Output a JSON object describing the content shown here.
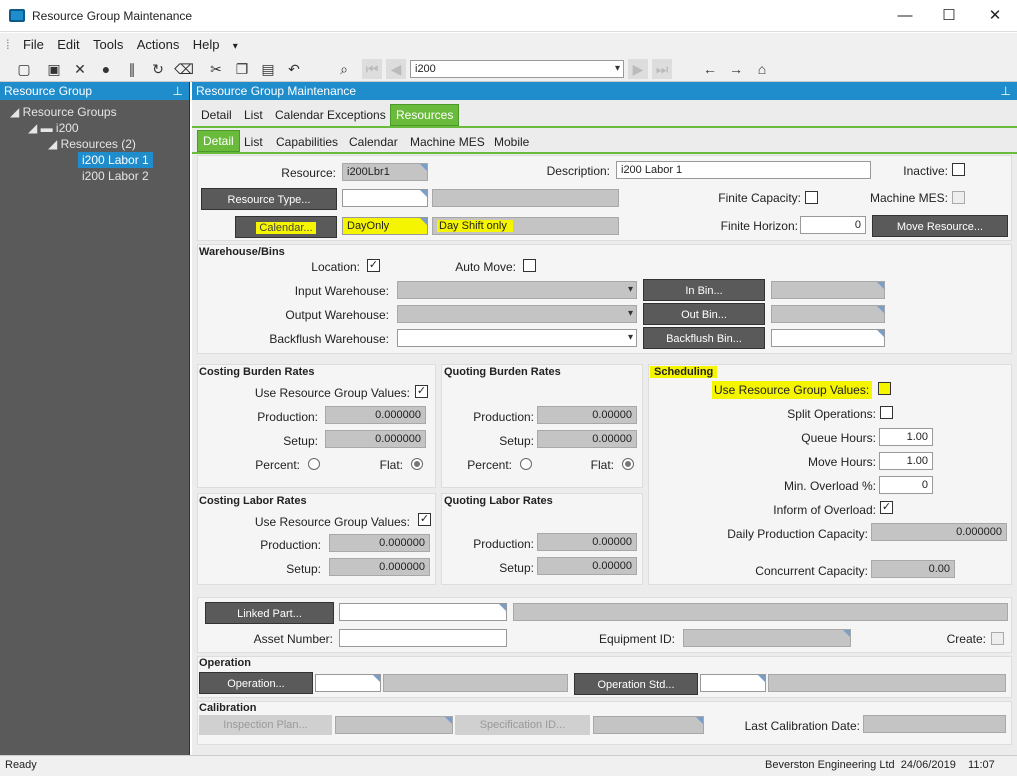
{
  "window": {
    "title": "Resource Group Maintenance",
    "minimize": "—",
    "maximize": "☐",
    "close": "✕"
  },
  "menu": [
    "File",
    "Edit",
    "Tools",
    "Actions",
    "Help"
  ],
  "toolbar": {
    "search_value": "i200"
  },
  "left_pane": {
    "title": "Resource Group",
    "tree": {
      "root": "Resource Groups",
      "group": "i200",
      "resources": "Resources (2)",
      "items": [
        "i200 Labor 1",
        "i200 Labor 2"
      ]
    }
  },
  "main": {
    "title": "Resource Group Maintenance",
    "tabs": [
      "Detail",
      "List",
      "Calendar Exceptions",
      "Resources"
    ],
    "subtabs": [
      "Detail",
      "List",
      "Capabilities",
      "Calendar",
      "Machine MES",
      "Mobile"
    ],
    "resource_label": "Resource:",
    "resource_value": "i200Lbr1",
    "description_label": "Description:",
    "description_value": "i200 Labor 1",
    "inactive_label": "Inactive:",
    "resource_type_btn": "Resource Type...",
    "finite_capacity_label": "Finite Capacity:",
    "machine_mes_label": "Machine MES:",
    "calendar_btn": "Calendar...",
    "calendar_value": "DayOnly",
    "calendar_desc": "Day Shift only",
    "finite_horizon_label": "Finite Horizon:",
    "finite_horizon_value": "0",
    "move_resource_btn": "Move Resource...",
    "warehouse": {
      "title": "Warehouse/Bins",
      "location_label": "Location:",
      "auto_move_label": "Auto Move:",
      "input_label": "Input Warehouse:",
      "output_label": "Output Warehouse:",
      "backflush_label": "Backflush Warehouse:",
      "in_bin_btn": "In Bin...",
      "out_bin_btn": "Out Bin...",
      "backflush_bin_btn": "Backflush Bin..."
    },
    "costing_burden": {
      "title": "Costing Burden Rates",
      "use_label": "Use Resource Group Values:",
      "production_label": "Production:",
      "production_value": "0.000000",
      "setup_label": "Setup:",
      "setup_value": "0.000000",
      "percent_label": "Percent:",
      "flat_label": "Flat:"
    },
    "quoting_burden": {
      "title": "Quoting Burden Rates",
      "production_label": "Production:",
      "production_value": "0.00000",
      "setup_label": "Setup:",
      "setup_value": "0.00000",
      "percent_label": "Percent:",
      "flat_label": "Flat:"
    },
    "costing_labor": {
      "title": "Costing Labor Rates",
      "use_label": "Use Resource Group Values:",
      "production_label": "Production:",
      "production_value": "0.000000",
      "setup_label": "Setup:",
      "setup_value": "0.000000"
    },
    "quoting_labor": {
      "title": "Quoting Labor Rates",
      "production_label": "Production:",
      "production_value": "0.00000",
      "setup_label": "Setup:",
      "setup_value": "0.00000"
    },
    "scheduling": {
      "title": "Scheduling",
      "use_label": "Use Resource Group Values:",
      "split_label": "Split Operations:",
      "queue_label": "Queue Hours:",
      "queue_value": "1.00",
      "move_label": "Move Hours:",
      "move_value": "1.00",
      "overload_label": "Min. Overload %:",
      "overload_value": "0",
      "inform_label": "Inform of Overload:",
      "daily_label": "Daily Production Capacity:",
      "daily_value": "0.000000",
      "concurrent_label": "Concurrent Capacity:",
      "concurrent_value": "0.00"
    },
    "linked_part_btn": "Linked Part...",
    "asset_label": "Asset Number:",
    "equipment_label": "Equipment ID:",
    "create_label": "Create:",
    "operation": {
      "title": "Operation",
      "operation_btn": "Operation...",
      "operation_std_btn": "Operation Std..."
    },
    "calibration": {
      "title": "Calibration",
      "inspection_btn": "Inspection Plan...",
      "specification_btn": "Specification ID...",
      "last_cal_label": "Last Calibration Date:"
    }
  },
  "status": {
    "left": "Ready",
    "right": "Beverston Engineering Ltd  24/06/2019    11:07"
  },
  "colors": {
    "accent": "#1f8ccc",
    "tab_active": "#6aba3c",
    "highlight": "#f5f500"
  }
}
